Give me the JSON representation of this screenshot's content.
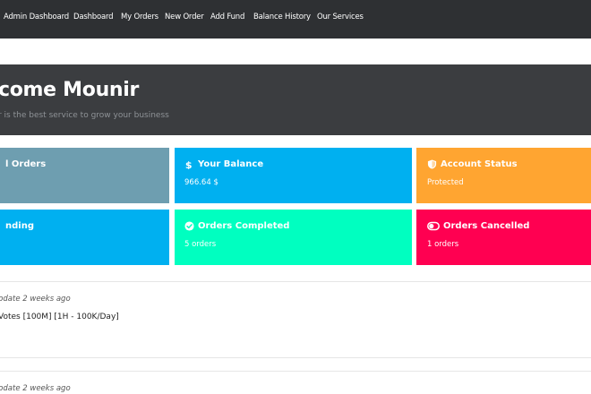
{
  "nav": {
    "items": [
      {
        "label": "Admin Dashboard"
      },
      {
        "label": "Dashboard"
      },
      {
        "label": "My Orders"
      },
      {
        "label": "New Order"
      },
      {
        "label": "Add Fund"
      },
      {
        "label": "Balance History"
      },
      {
        "label": "Our Services"
      }
    ]
  },
  "hero": {
    "title": "come Mounir",
    "subtitle": "r is the best service to grow your business"
  },
  "cards": [
    {
      "title": "l Orders",
      "value": "",
      "color": "#6e9eb0",
      "icon": ""
    },
    {
      "title": "Your Balance",
      "value": "966.64 $",
      "color": "#00b0f0",
      "icon": "dollar-icon"
    },
    {
      "title": "Account Status",
      "value": "Protected",
      "color": "#ffa531",
      "icon": "shield-icon"
    },
    {
      "title": "nding",
      "value": "",
      "color": "#00b0f0",
      "icon": ""
    },
    {
      "title": "Orders Completed",
      "value": "5 orders",
      "color": "#00ffc0",
      "icon": "check-circle-icon"
    },
    {
      "title": "Orders Cancelled",
      "value": "1 orders",
      "color": "#ff0051",
      "icon": "toggle-icon"
    }
  ],
  "updates": [
    {
      "meta": "pdate 2 weeks ago",
      "text": "Votes [100M] [1H - 100K/Day]"
    },
    {
      "meta": "pdate 2 weeks ago",
      "text": ""
    }
  ]
}
